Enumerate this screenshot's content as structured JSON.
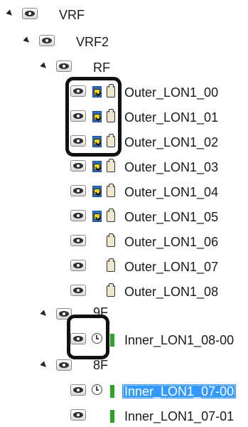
{
  "tree": {
    "vrf_label": "VRF",
    "vrf2_label": "VRF2",
    "rf_label": "RF",
    "outer_items": [
      "Outer_LON1_00",
      "Outer_LON1_01",
      "Outer_LON1_02",
      "Outer_LON1_03",
      "Outer_LON1_04",
      "Outer_LON1_05",
      "Outer_LON1_06",
      "Outer_LON1_07",
      "Outer_LON1_08"
    ],
    "floor_9_label": "9F",
    "inner_9": "Inner_LON1_08-00",
    "floor_8_label": "8F",
    "inner_8": [
      "Inner_LON1_07-00",
      "Inner_LON1_07-01"
    ]
  },
  "colors": {
    "selection": "#3399ff",
    "status_green": "#2aa52a",
    "highlight_border": "#111111"
  }
}
